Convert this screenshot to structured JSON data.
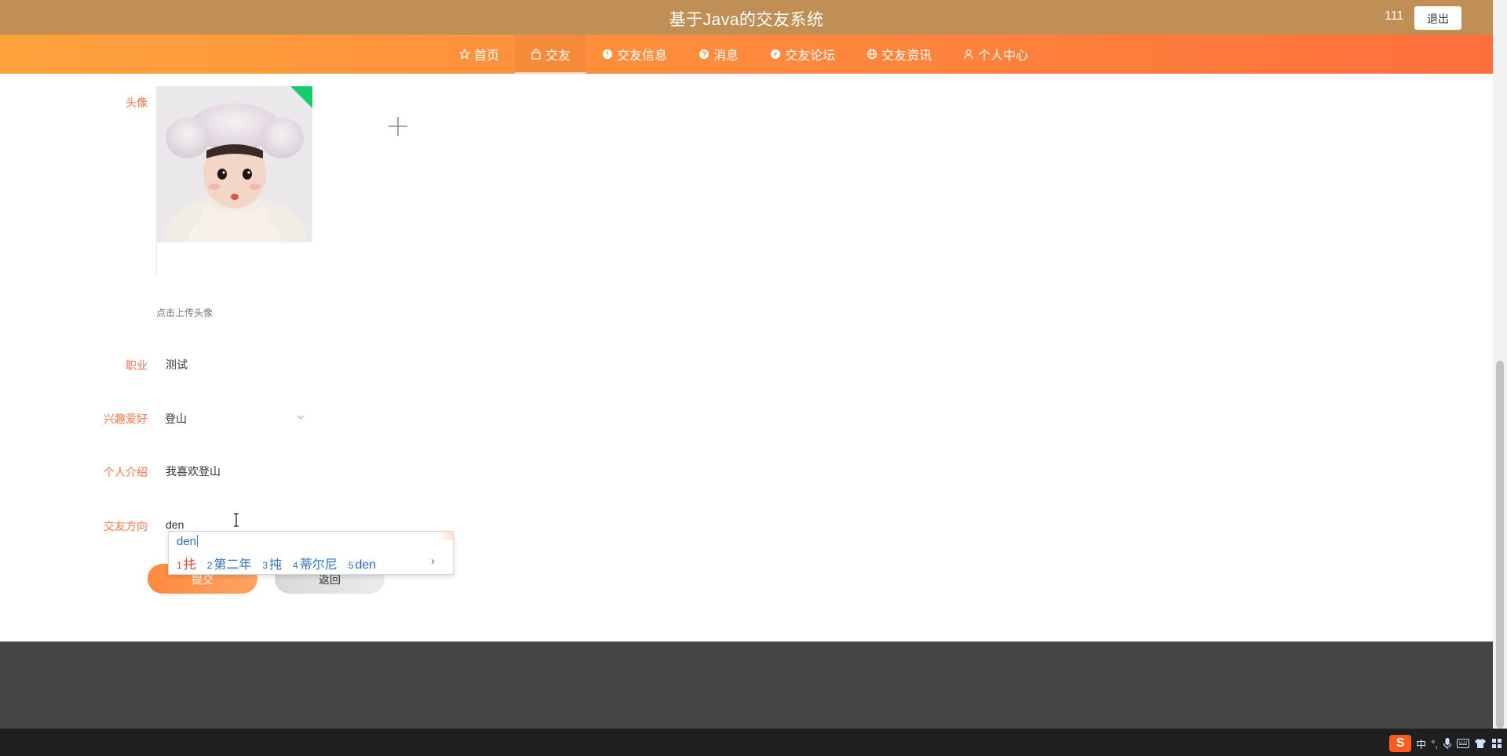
{
  "header": {
    "app_title": "基于Java的交友系统",
    "username": "111",
    "logout_label": "退出"
  },
  "nav": {
    "items": [
      {
        "label": "首页",
        "icon": "star-icon"
      },
      {
        "label": "交友",
        "icon": "bag-icon",
        "active": true
      },
      {
        "label": "交友信息",
        "icon": "info-icon"
      },
      {
        "label": "消息",
        "icon": "question-icon"
      },
      {
        "label": "交友论坛",
        "icon": "compass-icon"
      },
      {
        "label": "交友资讯",
        "icon": "globe-icon"
      },
      {
        "label": "个人中心",
        "icon": "user-icon"
      }
    ]
  },
  "form": {
    "avatar_label": "头像",
    "upload_hint": "点击上传头像",
    "occupation_label": "职业",
    "occupation_value": "测试",
    "hobby_label": "兴趣爱好",
    "hobby_value": "登山",
    "intro_label": "个人介绍",
    "intro_value": "我喜欢登山",
    "direction_label": "交友方向",
    "direction_value": "den",
    "submit_label": "提交",
    "back_label": "返回"
  },
  "ime": {
    "composition": "den",
    "candidates": [
      {
        "num": "1",
        "word": "扥"
      },
      {
        "num": "2",
        "word": "第二年"
      },
      {
        "num": "3",
        "word": "扽"
      },
      {
        "num": "4",
        "word": "蒂尔尼"
      },
      {
        "num": "5",
        "word": "den"
      }
    ],
    "next_arrow": "›"
  },
  "tray": {
    "lang": "中",
    "punct": "°,"
  },
  "colors": {
    "titlebar": "#bf8f56",
    "nav_start": "#ffa23c",
    "nav_end": "#ff6f3c",
    "label": "#ff7043",
    "footer": "#454545"
  }
}
